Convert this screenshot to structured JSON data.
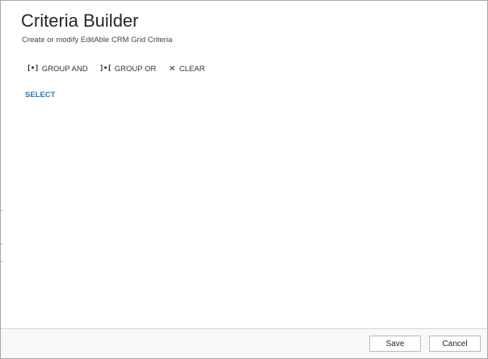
{
  "dialog": {
    "title": "Criteria Builder",
    "subtitle": "Create or modify EditAble CRM Grid Criteria"
  },
  "toolbar": {
    "group_and": {
      "icon": "[•]",
      "icon_name": "group-and-icon",
      "label": "GROUP AND"
    },
    "group_or": {
      "icon": "]•[",
      "icon_name": "group-or-icon",
      "label": "GROUP OR"
    },
    "clear": {
      "icon": "✕",
      "icon_name": "close-icon",
      "label": "CLEAR"
    }
  },
  "criteria": {
    "select_label": "SELECT"
  },
  "footer": {
    "save_label": "Save",
    "cancel_label": "Cancel"
  },
  "colors": {
    "link": "#2f75bd",
    "text": "#262626",
    "footer_bg": "#f8f8f8"
  }
}
